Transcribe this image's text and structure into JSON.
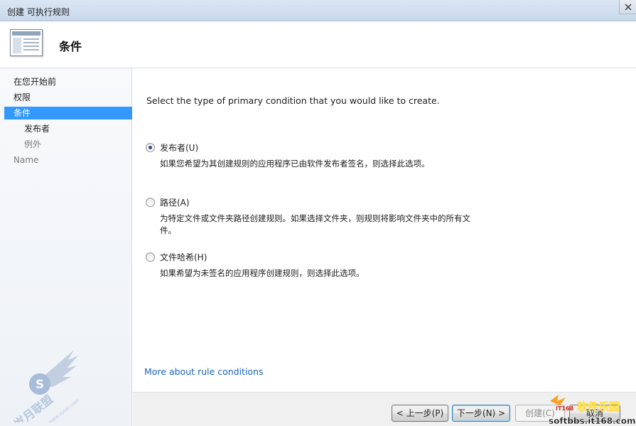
{
  "window": {
    "title": "创建 可执行规则"
  },
  "header": {
    "title": "条件",
    "icon": "page-icon"
  },
  "sidebar": {
    "items": [
      {
        "label": "在您开始前",
        "state": "normal"
      },
      {
        "label": "权限",
        "state": "normal"
      },
      {
        "label": "条件",
        "state": "selected"
      },
      {
        "label": "发布者",
        "state": "sub"
      },
      {
        "label": "例外",
        "state": "sub-disabled"
      },
      {
        "label": "Name",
        "state": "disabled"
      }
    ]
  },
  "main": {
    "intro": "Select the type of primary condition that you would like to create.",
    "options": [
      {
        "label": "发布者(U)",
        "description": "如果您希望为其创建规则的应用程序已由软件发布者签名，则选择此选项。",
        "checked": true
      },
      {
        "label": "路径(A)",
        "description": "为特定文件或文件夹路径创建规则。如果选择文件夹，则规则将影响文件夹中的所有文件。",
        "checked": false
      },
      {
        "label": "文件哈希(H)",
        "description": "如果希望为未签名的应用程序创建规则，则选择此选项。",
        "checked": false
      }
    ],
    "more_link": "More about rule conditions"
  },
  "footer": {
    "back_label": "< 上一步(P)",
    "next_label": "下一步(N) >",
    "create_label": "创建(C)",
    "cancel_label": "取消"
  },
  "watermarks": {
    "left_text": "岁月联盟",
    "left_url": "www.syue.com",
    "right_text": "软件乐园",
    "right_url": "softbbs.it168.com",
    "right_brand": "IT168"
  },
  "colors": {
    "selection": "#3399ff",
    "link": "#1a64b8",
    "titlebar": "#c8d8ec"
  }
}
